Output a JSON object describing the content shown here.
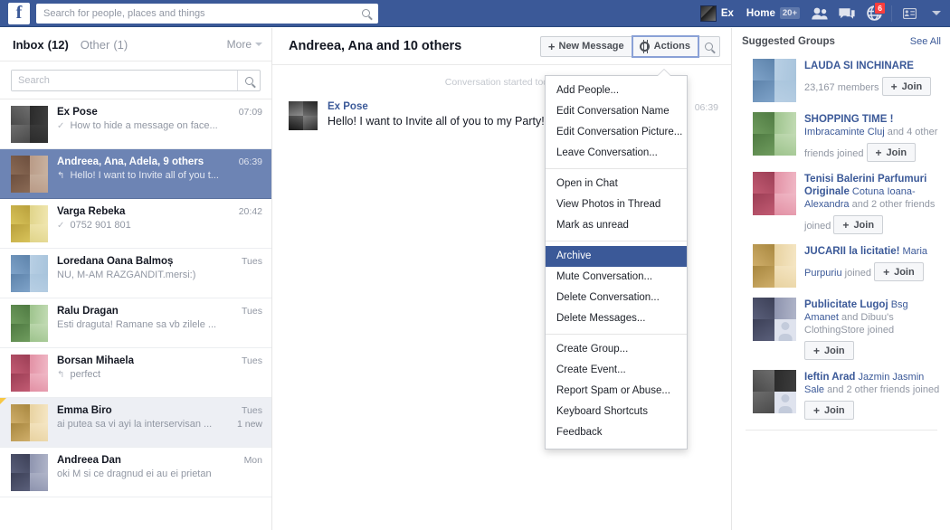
{
  "topbar": {
    "logo": "f",
    "search_placeholder": "Search for people, places and things",
    "search_value": "",
    "search_icon": "search-icon",
    "profile_name": "Ex",
    "home_label": "Home",
    "home_badge": "20+",
    "friends_icon": "friends-icon",
    "messages_icon": "messages-icon",
    "globe_icon": "globe-notifications-icon",
    "globe_badge": "6",
    "privacy_icon": "privacy-shortcuts-icon",
    "account_caret_icon": "chevron-down-icon"
  },
  "sidebar": {
    "inbox_label": "Inbox",
    "inbox_count": "(12)",
    "other_label": "Other",
    "other_count": "(1)",
    "more_label": "More",
    "more_caret_icon": "chevron-down-icon",
    "search_placeholder": "Search",
    "search_value": "",
    "search_icon": "search-icon",
    "threads": [
      {
        "name": "Ex Pose",
        "time": "07:09",
        "snippet": "How to hide a message on face...",
        "mark": "✓",
        "state": "read",
        "badge": "",
        "flag": false
      },
      {
        "name": "Andreea, Ana, Adela, 9 others",
        "time": "06:39",
        "snippet": "Hello! I want to Invite all of you t...",
        "mark": "↰",
        "state": "selected",
        "badge": "",
        "flag": false
      },
      {
        "name": "Varga Rebeka",
        "time": "20:42",
        "snippet": "0752 901 801",
        "mark": "✓",
        "state": "read",
        "badge": "",
        "flag": false
      },
      {
        "name": "Loredana Oana Balmoș",
        "time": "Tues",
        "snippet": "NU, M-AM RAZGANDIT.mersi:)",
        "mark": "",
        "state": "read",
        "badge": "",
        "flag": false
      },
      {
        "name": "Ralu Dragan",
        "time": "Tues",
        "snippet": "Esti draguta! Ramane sa vb zilele ...",
        "mark": "",
        "state": "read",
        "badge": "",
        "flag": false
      },
      {
        "name": "Borsan Mihaela",
        "time": "Tues",
        "snippet": "perfect",
        "mark": "↰",
        "state": "read",
        "badge": "",
        "flag": false
      },
      {
        "name": "Emma Biro",
        "time": "Tues",
        "snippet": "ai putea sa vi ayi la interservisan ...",
        "mark": "",
        "state": "unread",
        "badge": "1 new",
        "flag": true
      },
      {
        "name": "Andreea Dan",
        "time": "Mon",
        "snippet": "oki M si ce dragnud ei au ei prietan",
        "mark": "",
        "state": "read",
        "badge": "",
        "flag": false
      }
    ]
  },
  "conversation": {
    "title": "Andreea, Ana and 10 others",
    "new_message_label": "New Message",
    "new_message_icon": "plus-icon",
    "actions_label": "Actions",
    "actions_icon": "gear-icon",
    "search_icon": "search-icon",
    "started_note": "Conversation started today",
    "messages": [
      {
        "author": "Ex Pose",
        "text": "Hello! I want to Invite all of you to my Party!",
        "time": "06:39"
      }
    ]
  },
  "actions_menu": {
    "groups": [
      {
        "items": [
          {
            "label": "Add People...",
            "active": false
          },
          {
            "label": "Edit Conversation Name",
            "active": false
          },
          {
            "label": "Edit Conversation Picture...",
            "active": false
          },
          {
            "label": "Leave Conversation...",
            "active": false
          }
        ]
      },
      {
        "items": [
          {
            "label": "Open in Chat",
            "active": false
          },
          {
            "label": "View Photos in Thread",
            "active": false
          },
          {
            "label": "Mark as unread",
            "active": false
          }
        ]
      },
      {
        "items": [
          {
            "label": "Archive",
            "active": true
          },
          {
            "label": "Mute Conversation...",
            "active": false
          },
          {
            "label": "Delete Conversation...",
            "active": false
          },
          {
            "label": "Delete Messages...",
            "active": false
          }
        ]
      },
      {
        "items": [
          {
            "label": "Create Group...",
            "active": false
          },
          {
            "label": "Create Event...",
            "active": false
          },
          {
            "label": "Report Spam or Abuse...",
            "active": false
          },
          {
            "label": "Keyboard Shortcuts",
            "active": false
          },
          {
            "label": "Feedback",
            "active": false
          }
        ]
      }
    ]
  },
  "suggested_groups": {
    "title": "Suggested Groups",
    "see_all_label": "See All",
    "join_label": "Join",
    "join_icon": "plus-icon",
    "groups": [
      {
        "name": "LAUDA SI INCHINARE",
        "meta_plain": "23,167 members",
        "meta_highlight": "",
        "meta_tail": ""
      },
      {
        "name": "SHOPPING TIME !",
        "meta_plain": "",
        "meta_highlight": "Imbracaminte Cluj",
        "meta_tail": " and 4 other friends joined"
      },
      {
        "name": "Tenisi Balerini Parfumuri Originale",
        "meta_plain": "",
        "meta_highlight": "Cotuna Ioana-Alexandra",
        "meta_tail": " and 2 other friends joined"
      },
      {
        "name": "JUCARII la licitatie!",
        "meta_plain": "",
        "meta_highlight": "Maria Purpuriu",
        "meta_tail": " joined"
      },
      {
        "name": "Publicitate Lugoj",
        "meta_plain": "",
        "meta_highlight": "Bsg Amanet",
        "meta_tail": " and Dibuu's ClothingStore joined"
      },
      {
        "name": "Ieftin Arad",
        "meta_plain": "",
        "meta_highlight": "Jazmin Jasmin Sale",
        "meta_tail": " and 2 other friends joined"
      }
    ]
  },
  "colors": {
    "brand_blue": "#3b5998",
    "selected_thread": "#6d84b4",
    "unread_thread": "#edeff4",
    "link_blue": "#3b5998",
    "muted_text": "#9197a3",
    "badge_red": "#fa3e3e"
  }
}
